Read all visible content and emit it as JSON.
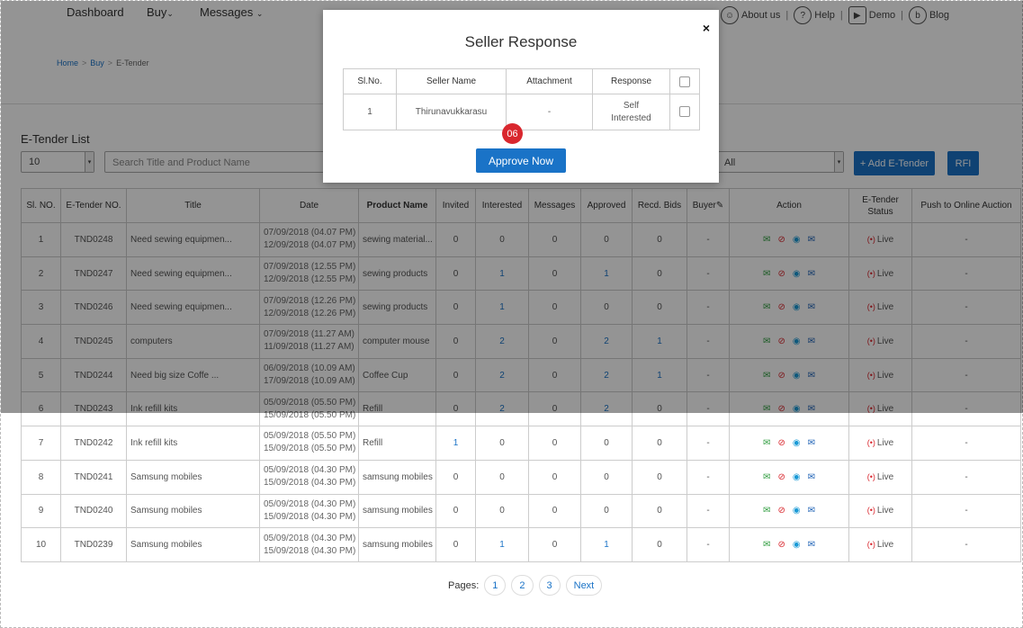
{
  "nav": {
    "dashboard": "Dashboard",
    "buy": "Buy",
    "messages": "Messages",
    "about": "About us",
    "help": "Help",
    "demo": "Demo",
    "blog": "Blog"
  },
  "breadcrumb": {
    "home": "Home",
    "buy": "Buy",
    "current": "E-Tender"
  },
  "list": {
    "title": "E-Tender List",
    "page_size": "10",
    "search_placeholder": "Search Title and Product Name",
    "status_filter": "All",
    "add_label": "+ Add E-Tender",
    "rfi_label": "RFI"
  },
  "table": {
    "headers": {
      "slno": "Sl. NO.",
      "tender_no": "E-Tender NO.",
      "title": "Title",
      "date": "Date",
      "product": "Product Name",
      "invited": "Invited",
      "interested": "Interested",
      "messages": "Messages",
      "approved": "Approved",
      "recd": "Recd. Bids",
      "buyer": "Buyer",
      "action": "Action",
      "status": "E-Tender Status",
      "push": "Push to Online Auction"
    },
    "rows": [
      {
        "sl": "1",
        "no": "TND0248",
        "title": "Need sewing equipmen...",
        "d1": "07/09/2018 (04.07 PM)",
        "d2": "12/09/2018 (04.07 PM)",
        "product": "sewing material...",
        "invited": "0",
        "interested": "0",
        "messages": "0",
        "approved": "0",
        "recd": "0",
        "buyer": "-",
        "status": "Live",
        "push": "-"
      },
      {
        "sl": "2",
        "no": "TND0247",
        "title": "Need sewing equipmen...",
        "d1": "07/09/2018 (12.55 PM)",
        "d2": "12/09/2018 (12.55 PM)",
        "product": "sewing products",
        "invited": "0",
        "interested": "1",
        "messages": "0",
        "approved": "1",
        "recd": "0",
        "buyer": "-",
        "status": "Live",
        "push": "-"
      },
      {
        "sl": "3",
        "no": "TND0246",
        "title": "Need sewing equipmen...",
        "d1": "07/09/2018 (12.26 PM)",
        "d2": "12/09/2018 (12.26 PM)",
        "product": "sewing products",
        "invited": "0",
        "interested": "1",
        "messages": "0",
        "approved": "0",
        "recd": "0",
        "buyer": "-",
        "status": "Live",
        "push": "-"
      },
      {
        "sl": "4",
        "no": "TND0245",
        "title": "computers",
        "d1": "07/09/2018 (11.27 AM)",
        "d2": "11/09/2018 (11.27 AM)",
        "product": "computer mouse",
        "invited": "0",
        "interested": "2",
        "messages": "0",
        "approved": "2",
        "recd": "1",
        "buyer": "-",
        "status": "Live",
        "push": "-"
      },
      {
        "sl": "5",
        "no": "TND0244",
        "title": "Need big size Coffe ...",
        "d1": "06/09/2018 (10.09 AM)",
        "d2": "17/09/2018 (10.09 AM)",
        "product": "Coffee Cup",
        "invited": "0",
        "interested": "2",
        "messages": "0",
        "approved": "2",
        "recd": "1",
        "buyer": "-",
        "status": "Live",
        "push": "-"
      },
      {
        "sl": "6",
        "no": "TND0243",
        "title": "Ink refill kits",
        "d1": "05/09/2018 (05.50 PM)",
        "d2": "15/09/2018 (05.50 PM)",
        "product": "Refill",
        "invited": "0",
        "interested": "2",
        "messages": "0",
        "approved": "2",
        "recd": "0",
        "buyer": "-",
        "status": "Live",
        "push": "-"
      },
      {
        "sl": "7",
        "no": "TND0242",
        "title": "Ink refill kits",
        "d1": "05/09/2018 (05.50 PM)",
        "d2": "15/09/2018 (05.50 PM)",
        "product": "Refill",
        "invited": "1",
        "interested": "0",
        "messages": "0",
        "approved": "0",
        "recd": "0",
        "buyer": "-",
        "status": "Live",
        "push": "-"
      },
      {
        "sl": "8",
        "no": "TND0241",
        "title": "Samsung mobiles",
        "d1": "05/09/2018 (04.30 PM)",
        "d2": "15/09/2018 (04.30 PM)",
        "product": "samsung mobiles",
        "invited": "0",
        "interested": "0",
        "messages": "0",
        "approved": "0",
        "recd": "0",
        "buyer": "-",
        "status": "Live",
        "push": "-"
      },
      {
        "sl": "9",
        "no": "TND0240",
        "title": "Samsung mobiles",
        "d1": "05/09/2018 (04.30 PM)",
        "d2": "15/09/2018 (04.30 PM)",
        "product": "samsung mobiles",
        "invited": "0",
        "interested": "0",
        "messages": "0",
        "approved": "0",
        "recd": "0",
        "buyer": "-",
        "status": "Live",
        "push": "-"
      },
      {
        "sl": "10",
        "no": "TND0239",
        "title": "Samsung mobiles",
        "d1": "05/09/2018 (04.30 PM)",
        "d2": "15/09/2018 (04.30 PM)",
        "product": "samsung mobiles",
        "invited": "0",
        "interested": "1",
        "messages": "0",
        "approved": "1",
        "recd": "0",
        "buyer": "-",
        "status": "Live",
        "push": "-"
      }
    ]
  },
  "pager": {
    "label": "Pages:",
    "pages": [
      "1",
      "2",
      "3"
    ],
    "next": "Next"
  },
  "modal": {
    "title": "Seller Response",
    "close": "×",
    "headers": {
      "slno": "Sl.No.",
      "seller": "Seller Name",
      "attachment": "Attachment",
      "response": "Response"
    },
    "row": {
      "slno": "1",
      "seller": "Thirunavukkarasu",
      "attachment": "-",
      "response_line1": "Self",
      "response_line2": "Interested"
    },
    "badge": "06",
    "approve": "Approve Now"
  },
  "colors": {
    "primary": "#1a73c7",
    "danger": "#d9272e",
    "success": "#2e9c3e"
  }
}
